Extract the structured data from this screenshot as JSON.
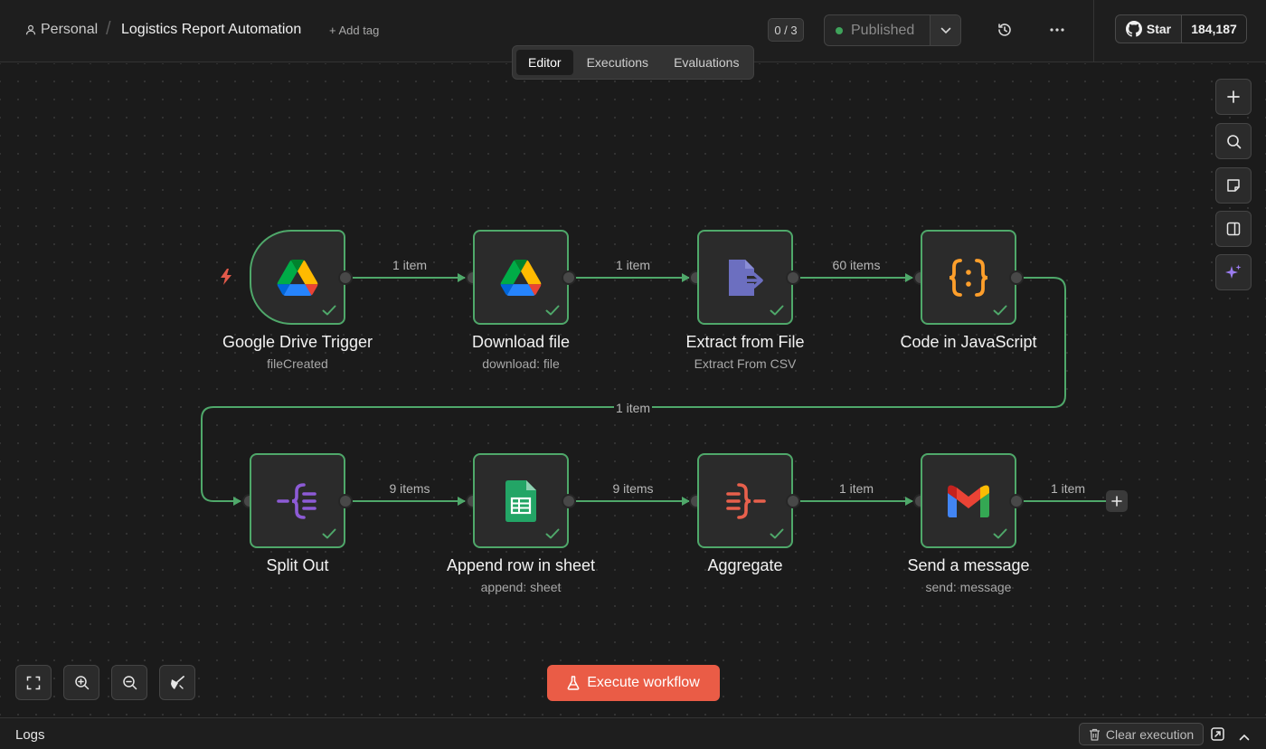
{
  "header": {
    "project": "Personal",
    "workflow_title": "Logistics Report Automation",
    "add_tag": "+ Add tag",
    "counter": "0 / 3",
    "publish_status": "Published",
    "github_star": "Star",
    "github_count": "184,187"
  },
  "tabs": [
    "Editor",
    "Executions",
    "Evaluations"
  ],
  "active_tab": "Editor",
  "nodes": [
    {
      "title": "Google Drive Trigger",
      "subtitle": "fileCreated"
    },
    {
      "title": "Download file",
      "subtitle": "download: file"
    },
    {
      "title": "Extract from File",
      "subtitle": "Extract From CSV"
    },
    {
      "title": "Code in JavaScript",
      "subtitle": ""
    },
    {
      "title": "Split Out",
      "subtitle": ""
    },
    {
      "title": "Append row in sheet",
      "subtitle": "append: sheet"
    },
    {
      "title": "Aggregate",
      "subtitle": ""
    },
    {
      "title": "Send a message",
      "subtitle": "send: message"
    }
  ],
  "connections": [
    "1 item",
    "1 item",
    "60 items",
    "1 item",
    "9 items",
    "9 items",
    "1 item",
    "1 item"
  ],
  "toolbar": {
    "execute_label": "Execute workflow"
  },
  "logs": {
    "label": "Logs",
    "clear_label": "Clear execution"
  },
  "colors": {
    "accent": "#ea5c46",
    "success": "#4fa86a",
    "background": "#1b1b1b"
  }
}
